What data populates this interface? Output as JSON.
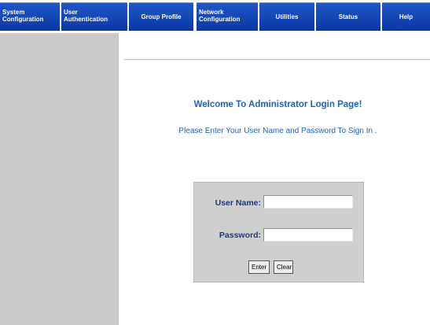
{
  "nav": {
    "items": [
      {
        "line1": "System",
        "line2": "Configuration"
      },
      {
        "line1": "User",
        "line2": "Authentication"
      },
      {
        "line1": "Group Profile"
      },
      {
        "line1": "Network",
        "line2": "Configuration"
      },
      {
        "line1": "Utilities"
      },
      {
        "line1": "Status"
      },
      {
        "line1": "Help"
      }
    ]
  },
  "main": {
    "welcome_title": "Welcome To Administrator Login Page!",
    "welcome_subtitle": "Please Enter Your User Name and Password To Sign In ."
  },
  "login": {
    "username_label": "User Name:",
    "username_value": "",
    "password_label": "Password:",
    "password_value": "",
    "enter_label": "Enter",
    "clear_label": "Clear"
  },
  "colors": {
    "nav_bg": "#0b3aa6",
    "sidebar_bg": "#c9c9c9",
    "heading_blue": "#1e64b4",
    "label_blue": "#1d3a7a",
    "login_box_bg": "#cfcfcf"
  }
}
